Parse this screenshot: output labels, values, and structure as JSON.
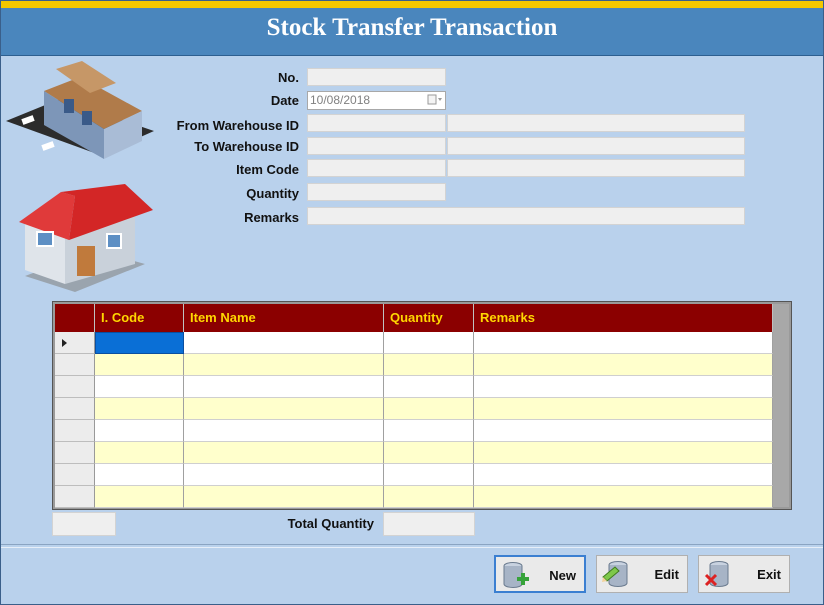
{
  "window": {
    "title": "Stock Transfer Transaction"
  },
  "form": {
    "no_label": "No.",
    "date_label": "Date",
    "date_value": "10/08/2018",
    "from_label": "From Warehouse ID",
    "to_label": "To Warehouse ID",
    "item_label": "Item Code",
    "qty_label": "Quantity",
    "remarks_label": "Remarks"
  },
  "grid": {
    "columns": [
      "I. Code",
      "Item Name",
      "Quantity",
      "Remarks"
    ],
    "row_count": 8
  },
  "footer": {
    "total_label": "Total Quantity"
  },
  "buttons": {
    "new": "New",
    "edit": "Edit",
    "exit": "Exit"
  },
  "colors": {
    "title_bg": "#4a86bd",
    "header_bg": "#8b0000",
    "header_text": "#ffd700",
    "alt_row": "#ffffcc",
    "form_bg": "#b9d1ec"
  }
}
